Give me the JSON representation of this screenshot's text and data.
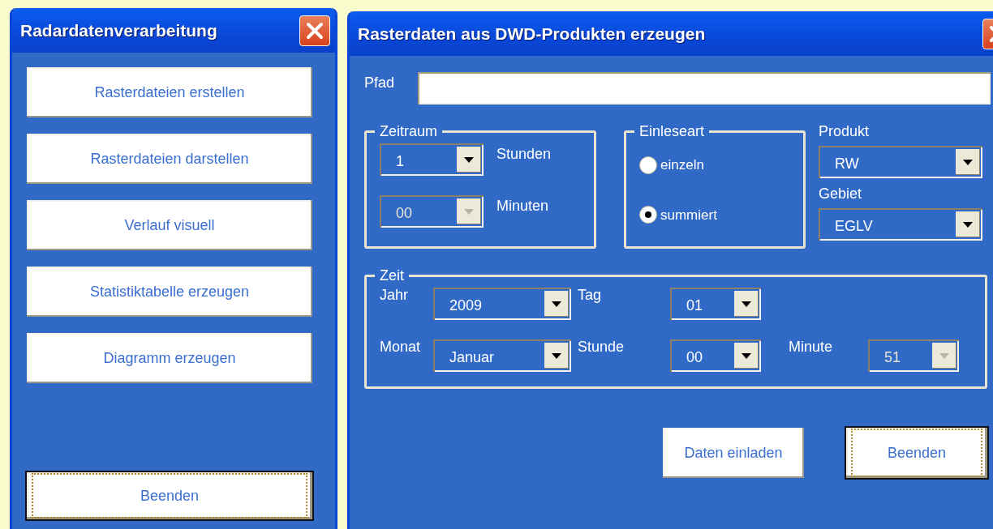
{
  "menu_window": {
    "title": "Radardatenverarbeitung",
    "buttons": [
      {
        "label": "Rasterdateien erstellen",
        "focused": false
      },
      {
        "label": "Rasterdateien darstellen",
        "focused": false
      },
      {
        "label": "Verlauf visuell",
        "focused": false
      },
      {
        "label": "Statistiktabelle erzeugen",
        "focused": false
      },
      {
        "label": "Diagramm erzeugen",
        "focused": false
      }
    ],
    "exit_button": {
      "label": "Beenden",
      "focused": true
    }
  },
  "dialog": {
    "title": "Rasterdaten aus DWD-Produkten erzeugen",
    "path": {
      "label": "Pfad"
    },
    "zeitraum": {
      "legend": "Zeitraum",
      "rows": [
        {
          "value": "1",
          "label": "Stunden",
          "disabled": false
        },
        {
          "value": "00",
          "label": "Minuten",
          "disabled": true
        }
      ]
    },
    "einleseart": {
      "legend": "Einleseart",
      "options": [
        {
          "label": "einzeln",
          "selected": false
        },
        {
          "label": "summiert",
          "selected": true
        }
      ]
    },
    "selects": [
      {
        "label": "Produkt",
        "value": "RW",
        "disabled": false
      },
      {
        "label": "Gebiet",
        "value": "EGLV",
        "disabled": false
      }
    ],
    "zeit": {
      "legend": "Zeit",
      "rows": [
        [
          {
            "label": "Jahr",
            "value": "2009",
            "disabled": false
          },
          {
            "label": "Tag",
            "value": "01",
            "disabled": false
          }
        ],
        [
          {
            "label": "Monat",
            "value": "Januar",
            "disabled": false
          },
          {
            "label": "Stunde",
            "value": "00",
            "disabled": false
          },
          {
            "label": "Minute",
            "value": "51",
            "disabled": true
          }
        ]
      ]
    },
    "buttons": [
      {
        "label": "Daten einladen",
        "focused": false
      },
      {
        "label": "Beenden",
        "focused": true
      }
    ]
  }
}
